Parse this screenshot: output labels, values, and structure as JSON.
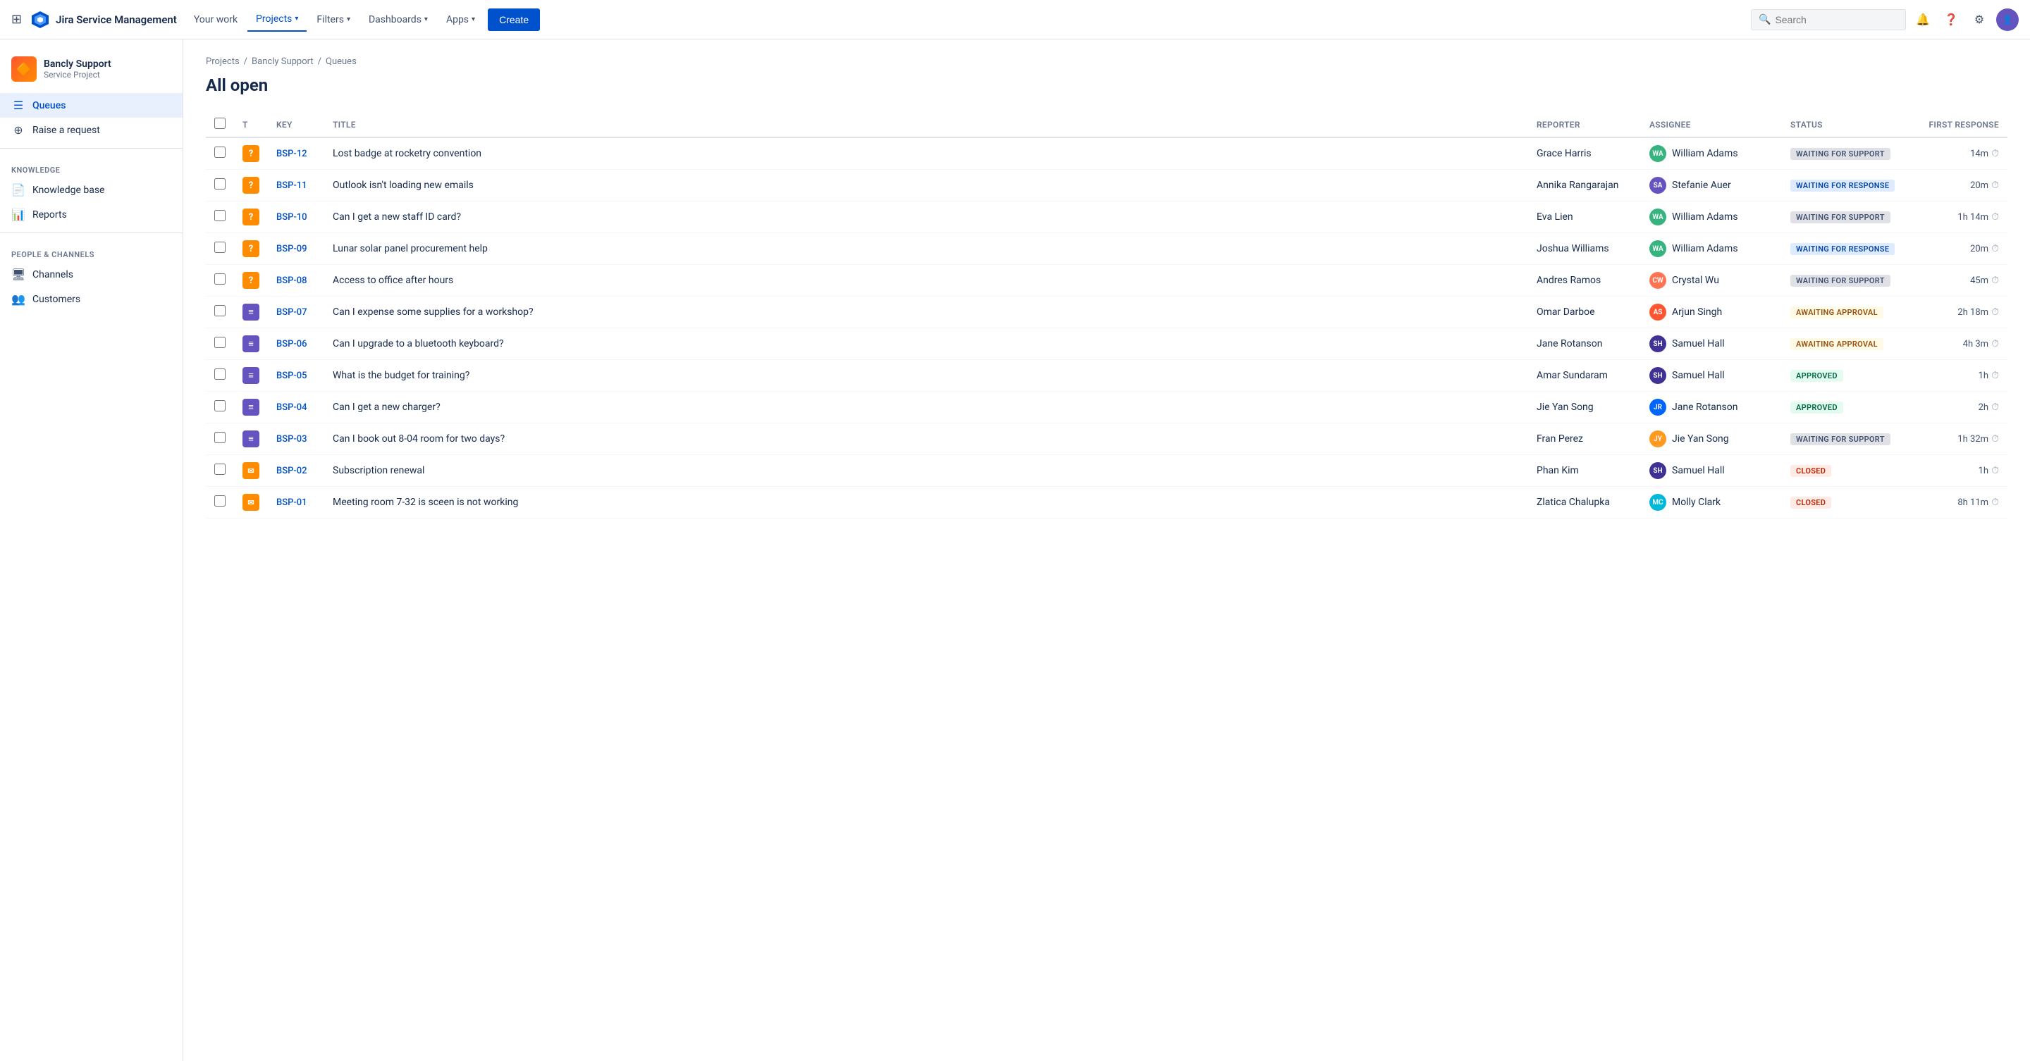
{
  "app": {
    "name": "Jira Service Management"
  },
  "topnav": {
    "your_work": "Your work",
    "projects": "Projects",
    "filters": "Filters",
    "dashboards": "Dashboards",
    "apps": "Apps",
    "create": "Create",
    "search_placeholder": "Search"
  },
  "sidebar": {
    "project_name": "Bancly Support",
    "project_type": "Service Project",
    "queues": "Queues",
    "raise_request": "Raise a request",
    "knowledge_section": "KNOWLEDGE",
    "knowledge_base": "Knowledge base",
    "reports": "Reports",
    "people_section": "PEOPLE & CHANNELS",
    "channels": "Channels",
    "customers": "Customers"
  },
  "breadcrumb": {
    "projects": "Projects",
    "bancly_support": "Bancly Support",
    "queues": "Queues"
  },
  "page": {
    "title": "All open"
  },
  "table": {
    "headers": {
      "type": "T",
      "key": "Key",
      "title": "Title",
      "reporter": "Reporter",
      "assignee": "Assignee",
      "status": "Status",
      "first_response": "First response"
    },
    "rows": [
      {
        "key": "BSP-12",
        "type": "question",
        "title": "Lost badge at rocketry convention",
        "reporter": "Grace Harris",
        "assignee": "William Adams",
        "assignee_initials": "WA",
        "assignee_class": "av-wa",
        "status": "WAITING FOR SUPPORT",
        "status_class": "status-waiting-support",
        "response": "14m"
      },
      {
        "key": "BSP-11",
        "type": "question",
        "title": "Outlook isn't loading new emails",
        "reporter": "Annika Rangarajan",
        "assignee": "Stefanie Auer",
        "assignee_initials": "SA",
        "assignee_class": "av-sa",
        "status": "WAITING FOR RESPONSE",
        "status_class": "status-waiting-response",
        "response": "20m"
      },
      {
        "key": "BSP-10",
        "type": "question",
        "title": "Can I get a new staff ID card?",
        "reporter": "Eva Lien",
        "assignee": "William Adams",
        "assignee_initials": "WA",
        "assignee_class": "av-wa",
        "status": "WAITING FOR SUPPORT",
        "status_class": "status-waiting-support",
        "response": "1h 14m"
      },
      {
        "key": "BSP-09",
        "type": "question",
        "title": "Lunar solar panel procurement help",
        "reporter": "Joshua Williams",
        "assignee": "William Adams",
        "assignee_initials": "WA",
        "assignee_class": "av-wa",
        "status": "WAITING FOR RESPONSE",
        "status_class": "status-waiting-response",
        "response": "20m"
      },
      {
        "key": "BSP-08",
        "type": "question",
        "title": "Access to office after hours",
        "reporter": "Andres Ramos",
        "assignee": "Crystal Wu",
        "assignee_initials": "CW",
        "assignee_class": "av-cw",
        "status": "WAITING FOR SUPPORT",
        "status_class": "status-waiting-support",
        "response": "45m"
      },
      {
        "key": "BSP-07",
        "type": "task",
        "title": "Can I expense some supplies for a workshop?",
        "reporter": "Omar Darboe",
        "assignee": "Arjun Singh",
        "assignee_initials": "AS",
        "assignee_class": "av-as",
        "status": "AWAITING APPROVAL",
        "status_class": "status-awaiting-approval",
        "response": "2h 18m"
      },
      {
        "key": "BSP-06",
        "type": "task",
        "title": "Can I upgrade to a bluetooth keyboard?",
        "reporter": "Jane Rotanson",
        "assignee": "Samuel Hall",
        "assignee_initials": "SH",
        "assignee_class": "av-sh",
        "status": "AWAITING APPROVAL",
        "status_class": "status-awaiting-approval",
        "response": "4h 3m"
      },
      {
        "key": "BSP-05",
        "type": "task",
        "title": "What is the budget for training?",
        "reporter": "Amar Sundaram",
        "assignee": "Samuel Hall",
        "assignee_initials": "SH",
        "assignee_class": "av-sh",
        "status": "APPROVED",
        "status_class": "status-approved",
        "response": "1h"
      },
      {
        "key": "BSP-04",
        "type": "task",
        "title": "Can I get a new charger?",
        "reporter": "Jie Yan Song",
        "assignee": "Jane Rotanson",
        "assignee_initials": "JR",
        "assignee_class": "av-jrs",
        "status": "APPROVED",
        "status_class": "status-approved",
        "response": "2h"
      },
      {
        "key": "BSP-03",
        "type": "task",
        "title": "Can I book out 8-04 room for two days?",
        "reporter": "Fran Perez",
        "assignee": "Jie Yan Song",
        "assignee_initials": "JY",
        "assignee_class": "av-jy",
        "status": "WAITING FOR SUPPORT",
        "status_class": "status-waiting-support",
        "response": "1h 32m"
      },
      {
        "key": "BSP-02",
        "type": "email",
        "title": "Subscription renewal",
        "reporter": "Phan Kim",
        "assignee": "Samuel Hall",
        "assignee_initials": "SH",
        "assignee_class": "av-sh",
        "status": "CLOSED",
        "status_class": "status-closed",
        "response": "1h"
      },
      {
        "key": "BSP-01",
        "type": "email",
        "title": "Meeting room 7-32 is sceen is not working",
        "reporter": "Zlatica Chalupka",
        "assignee": "Molly Clark",
        "assignee_initials": "MC",
        "assignee_class": "av-mc",
        "status": "CLOSED",
        "status_class": "status-closed",
        "response": "8h 11m"
      }
    ]
  }
}
